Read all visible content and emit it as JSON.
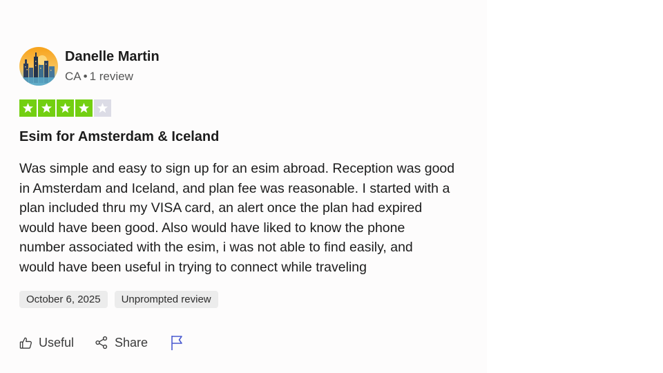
{
  "reviewer": {
    "name": "Danelle Martin",
    "country": "CA",
    "separator": "•",
    "review_count": "1 review",
    "avatar_icon": "city-skyline-avatar"
  },
  "rating": {
    "value": 4,
    "max": 5,
    "filled_color": "#00b67a",
    "filled_color_alt": "#73cf11",
    "empty_color": "#dcdce6"
  },
  "review": {
    "title": "Esim for Amsterdam & Iceland",
    "body_lines": [
      "Was simple and easy to sign up for an esim abroad. Reception was good",
      "in Amsterdam and Iceland, and plan fee was reasonable. I started with a",
      "plan included thru my VISA card, an alert once the plan had expired",
      "would have been good. Also would have liked to know the phone",
      "number associated with the esim, i was not able to find easily, and",
      "would have been useful in trying to connect while traveling"
    ]
  },
  "tags": {
    "date": "October 6, 2025",
    "review_type": "Unprompted review"
  },
  "actions": {
    "useful_label": "Useful",
    "useful_icon": "thumbs-up-icon",
    "share_label": "Share",
    "share_icon": "share-icon",
    "report_icon": "flag-icon",
    "report_color": "#4a5ad0"
  }
}
